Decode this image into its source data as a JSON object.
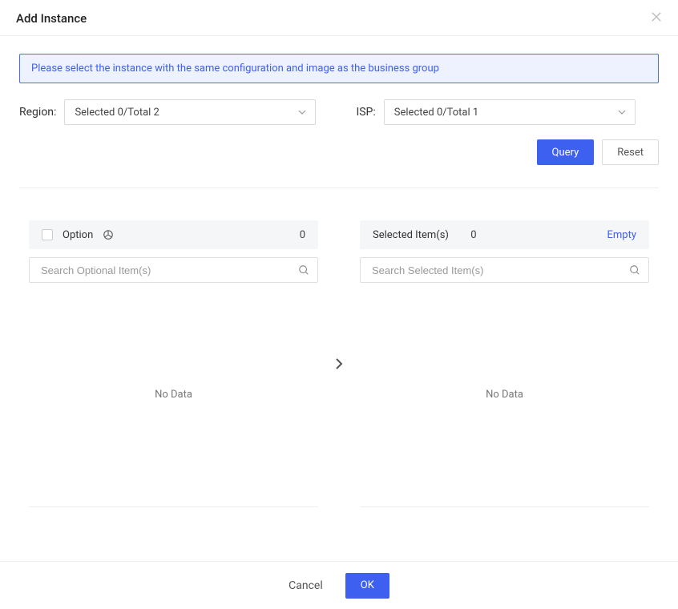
{
  "header": {
    "title": "Add Instance"
  },
  "notice": "Please select the instance with the same configuration and image as the business group",
  "filters": {
    "region": {
      "label": "Region:",
      "value": "Selected 0/Total 2"
    },
    "isp": {
      "label": "ISP:",
      "value": "Selected 0/Total 1"
    }
  },
  "buttons": {
    "query": "Query",
    "reset": "Reset"
  },
  "transfer": {
    "left": {
      "title": "Option",
      "count": "0",
      "search_placeholder": "Search Optional Item(s)",
      "no_data": "No Data"
    },
    "right": {
      "title": "Selected Item(s)",
      "count": "0",
      "empty_action": "Empty",
      "search_placeholder": "Search Selected Item(s)",
      "no_data": "No Data"
    }
  },
  "footer": {
    "cancel": "Cancel",
    "ok": "OK"
  }
}
